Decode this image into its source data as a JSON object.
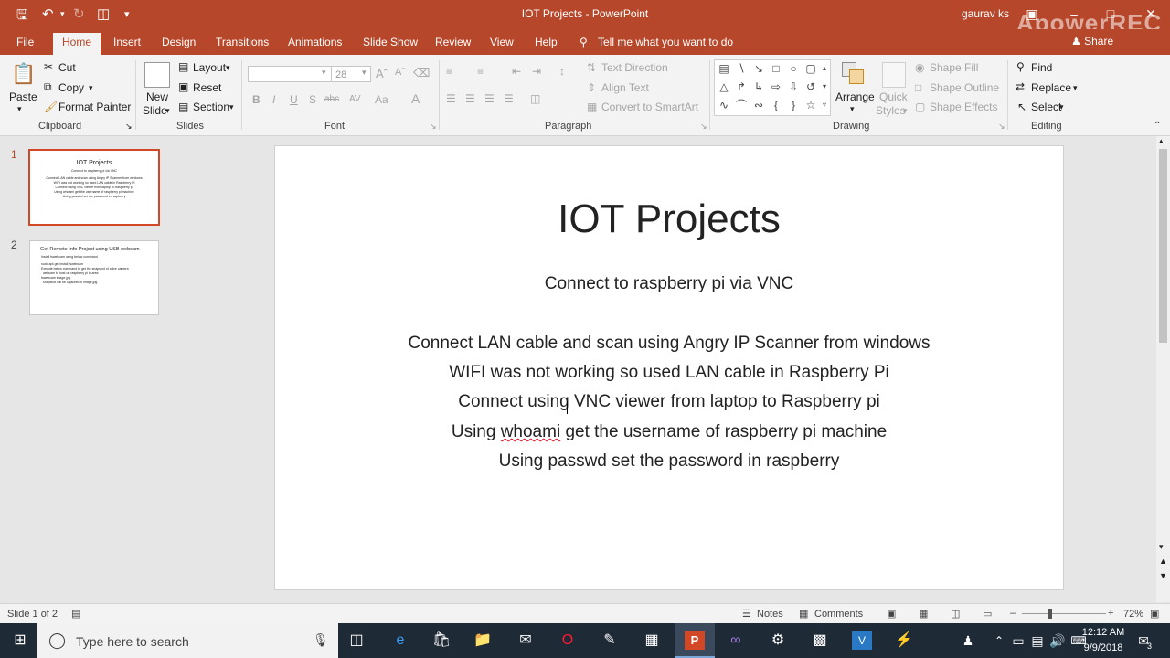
{
  "window": {
    "title": "IOT Projects  -  PowerPoint",
    "user": "gaurav ks",
    "watermark": "ApowerREC"
  },
  "tabs": [
    "File",
    "Home",
    "Insert",
    "Design",
    "Transitions",
    "Animations",
    "Slide Show",
    "Review",
    "View",
    "Help"
  ],
  "tell_me": "Tell me what you want to do",
  "share_label": "Share",
  "ribbon": {
    "clipboard": {
      "paste": "Paste",
      "cut": "Cut",
      "copy": "Copy",
      "format_painter": "Format Painter",
      "label": "Clipboard"
    },
    "slides": {
      "new_slide_1": "New",
      "new_slide_2": "Slide",
      "layout": "Layout",
      "reset": "Reset",
      "section": "Section",
      "label": "Slides"
    },
    "font": {
      "size": "28",
      "bold": "B",
      "italic": "I",
      "underline": "U",
      "shadow": "S",
      "strike": "abc",
      "spacing": "AV",
      "case": "Aa",
      "label": "Font"
    },
    "paragraph": {
      "text_direction": "Text Direction",
      "align_text": "Align Text",
      "convert": "Convert to SmartArt",
      "label": "Paragraph"
    },
    "drawing": {
      "arrange": "Arrange",
      "quick_styles_1": "Quick",
      "quick_styles_2": "Styles",
      "shape_fill": "Shape Fill",
      "shape_outline": "Shape Outline",
      "shape_effects": "Shape Effects",
      "label": "Drawing"
    },
    "editing": {
      "find": "Find",
      "replace": "Replace",
      "select": "Select",
      "label": "Editing"
    }
  },
  "thumbnails": [
    {
      "num": "1",
      "title": "IOT Projects",
      "lines": [
        "Connect to raspberry pi via VNC",
        "Connect LAN cable and scan using Angry IP Scanner from windows",
        "WIFI was not working so used LAN cable in Raspberry Pi",
        "Connect using VNC viewer from laptop to Raspberry pi",
        "Using whoami get the username of raspberry pi machine",
        "Using passwd set the password in raspberry"
      ]
    },
    {
      "num": "2",
      "title": "Get Remote Info Project using USB webcam",
      "lines": [
        "Install fswebcam using below command",
        "sudo apt-get install fswebcam",
        "Execute below command to get the snapshot of a live camera",
        "webcam to host on raspberry pi in area",
        "fswebcam image.jpg",
        "snapshot will be captured in image.jpg"
      ]
    }
  ],
  "slide": {
    "title": "IOT Projects",
    "subtitle": "Connect to raspberry pi via VNC",
    "lines": [
      "Connect LAN cable and scan using Angry IP Scanner from windows",
      "WIFI was not working so used LAN cable in Raspberry Pi",
      "Connect using VNC viewer from laptop to Raspberry pi",
      "Using passwd set the password in raspberry"
    ],
    "line4_pre": "Using ",
    "line4_word": "whoami",
    "line4_post": " get the username of raspberry pi machine"
  },
  "status": {
    "slide_of": "Slide 1 of 2",
    "notes": "Notes",
    "comments": "Comments",
    "zoom": "72%"
  },
  "taskbar": {
    "search_placeholder": "Type here to search",
    "time": "12:12 AM",
    "date": "9/9/2018",
    "notif_count": "3"
  },
  "colors": {
    "accent": "#b7472a",
    "selection": "#d24726"
  }
}
